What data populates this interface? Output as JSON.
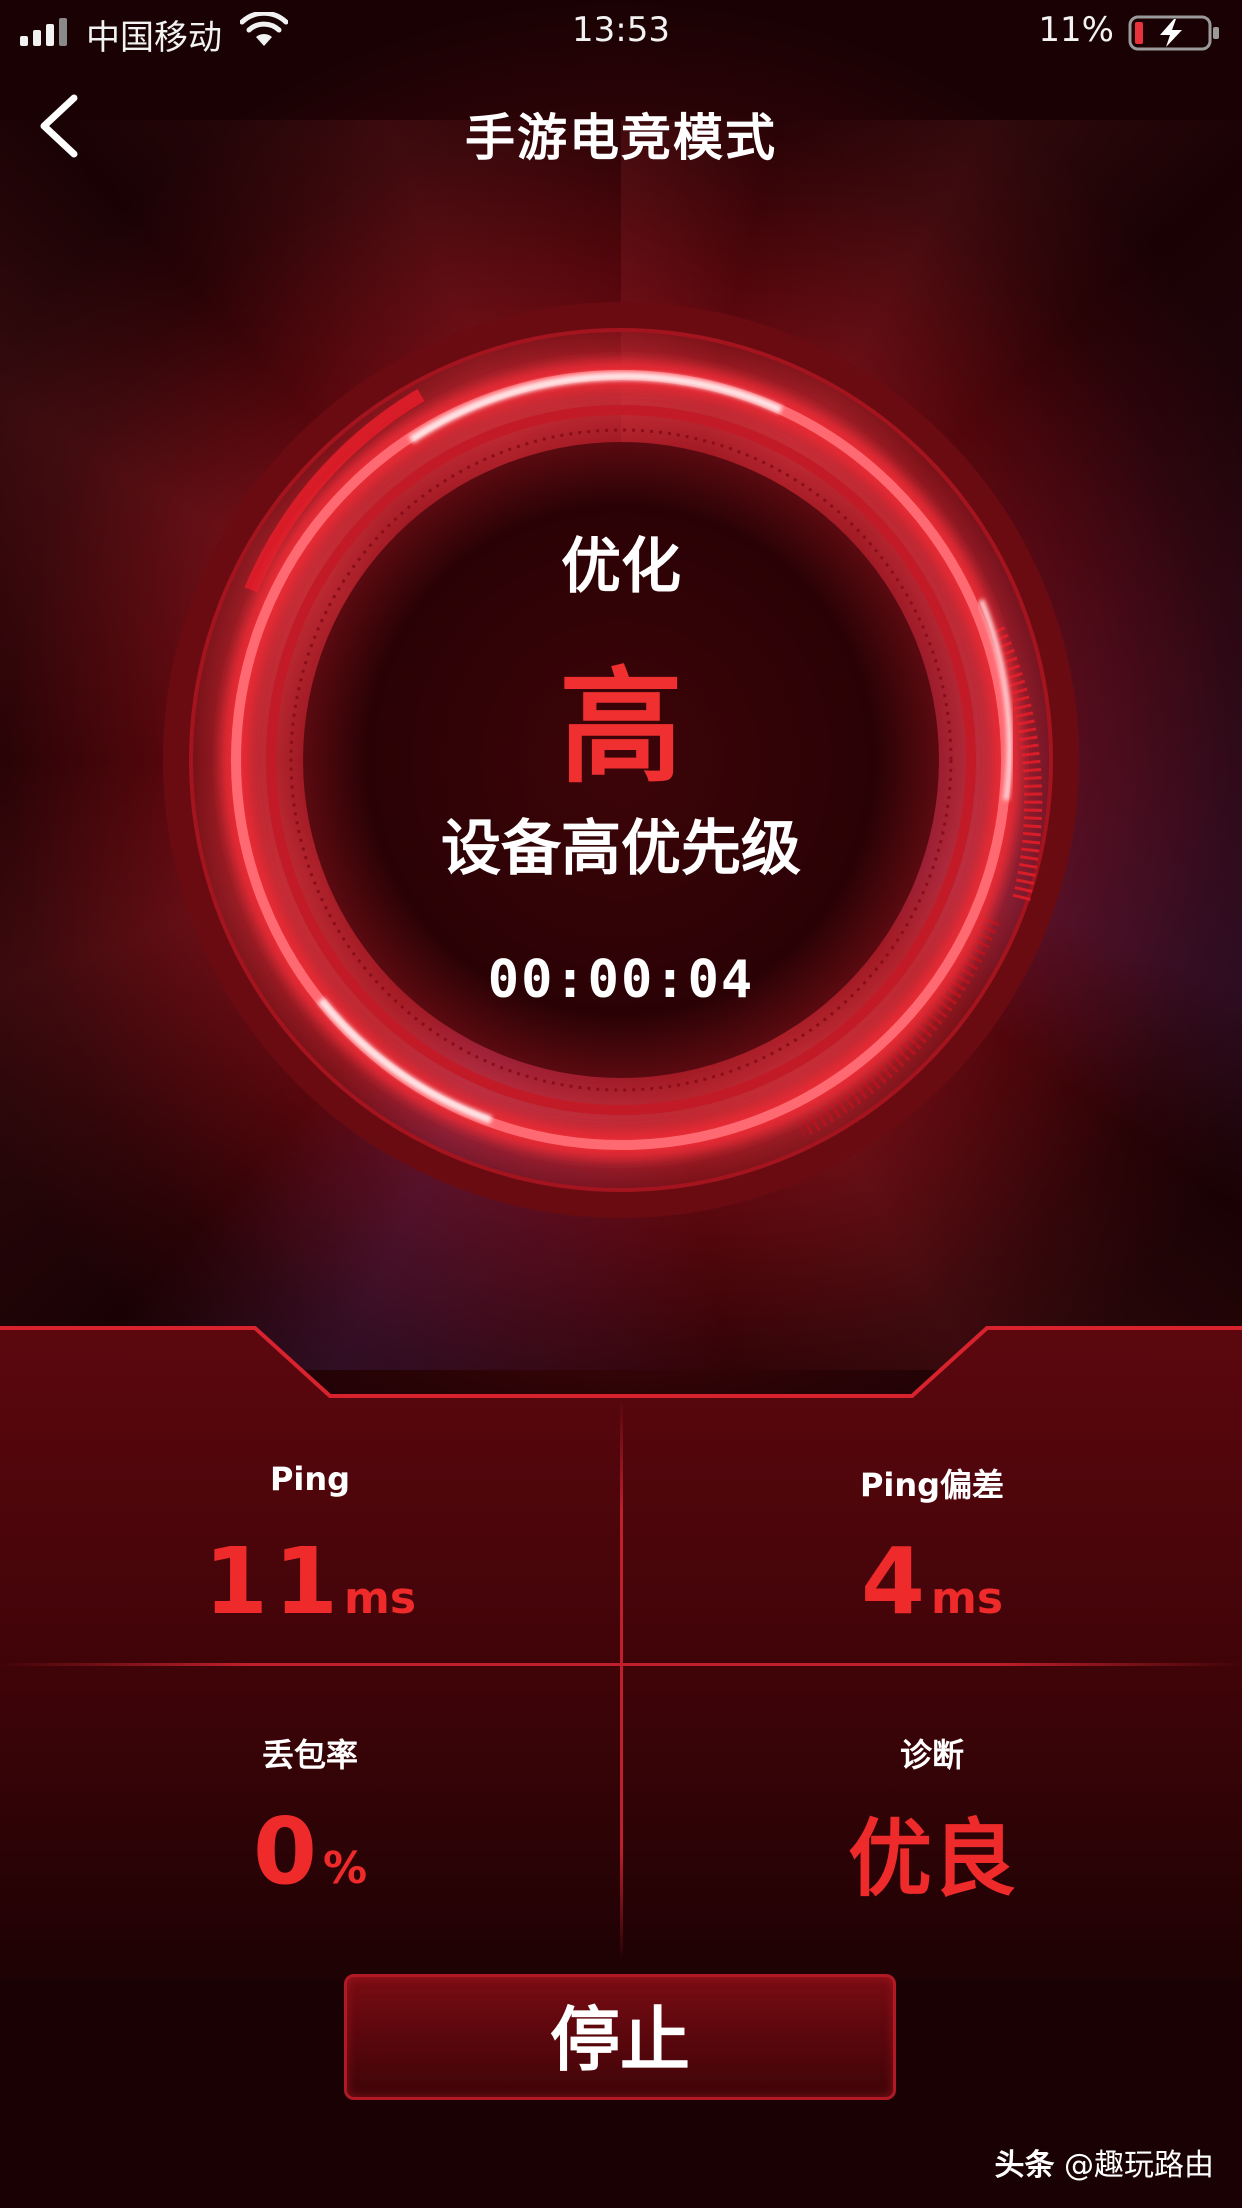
{
  "status_bar": {
    "carrier": "中国移动",
    "time": "13:53",
    "battery_percent": "11%"
  },
  "nav": {
    "title": "手游电竞模式"
  },
  "dial": {
    "label": "优化",
    "level": "高",
    "description": "设备高优先级",
    "timer": "00:00:04"
  },
  "stats": {
    "ping": {
      "label": "Ping",
      "value": "11",
      "unit": "ms"
    },
    "ping_deviation": {
      "label": "Ping偏差",
      "value": "4",
      "unit": "ms"
    },
    "packet_loss": {
      "label": "丢包率",
      "value": "0",
      "unit": "%"
    },
    "diagnosis": {
      "label": "诊断",
      "value": "优良"
    }
  },
  "actions": {
    "stop_label": "停止"
  },
  "watermark": {
    "brand": "头条",
    "handle": "@趣玩路由"
  },
  "colors": {
    "accent": "#ee2a2a",
    "background": "#1a0204",
    "ring": "#d21e2a"
  }
}
